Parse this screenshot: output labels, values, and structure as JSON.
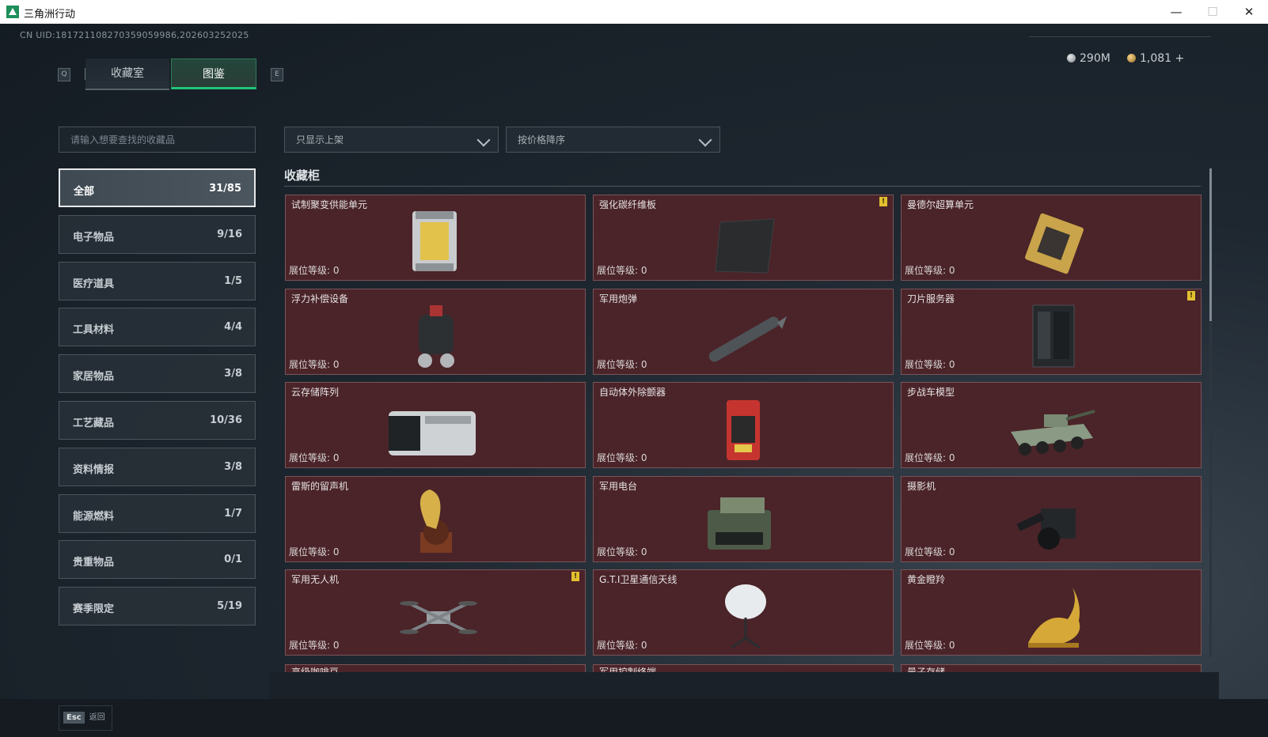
{
  "window": {
    "title": "三角洲行动",
    "min": "—",
    "max": "☐",
    "close": "✕"
  },
  "uid": "CN UID:181721108270359059986,202603252025",
  "currency": {
    "silver": "290M",
    "gold": "1,081 +"
  },
  "tabs": {
    "key_left": "Q",
    "key_right": "E",
    "items": [
      {
        "label": "收藏室",
        "active": false
      },
      {
        "label": "图鉴",
        "active": true
      }
    ]
  },
  "search": {
    "placeholder": "请输入想要查找的收藏品",
    "value": ""
  },
  "filters": {
    "shelf": "只显示上架",
    "sort": "按价格降序"
  },
  "categories": [
    {
      "label": "全部",
      "count": "31/85",
      "active": true
    },
    {
      "label": "电子物品",
      "count": "9/16"
    },
    {
      "label": "医疗道具",
      "count": "1/5"
    },
    {
      "label": "工具材料",
      "count": "4/4"
    },
    {
      "label": "家居物品",
      "count": "3/8"
    },
    {
      "label": "工艺藏品",
      "count": "10/36"
    },
    {
      "label": "资料情报",
      "count": "3/8"
    },
    {
      "label": "能源燃料",
      "count": "1/7"
    },
    {
      "label": "贵重物品",
      "count": "0/1"
    },
    {
      "label": "赛季限定",
      "count": "5/19"
    }
  ],
  "section_title": "收藏柜",
  "level_label": "展位等级: 0",
  "items": [
    {
      "name": "试制聚变供能单元",
      "icon": "fusion-unit-icon",
      "alert": false
    },
    {
      "name": "强化碳纤维板",
      "icon": "carbon-plate-icon",
      "alert": true
    },
    {
      "name": "曼德尔超算单元",
      "icon": "supercomputer-chip-icon",
      "alert": false
    },
    {
      "name": "浮力补偿设备",
      "icon": "buoyancy-device-icon",
      "alert": false
    },
    {
      "name": "军用炮弹",
      "icon": "artillery-shell-icon",
      "alert": false
    },
    {
      "name": "刀片服务器",
      "icon": "blade-server-icon",
      "alert": true
    },
    {
      "name": "云存储阵列",
      "icon": "storage-array-icon",
      "alert": false
    },
    {
      "name": "自动体外除颤器",
      "icon": "defibrillator-icon",
      "alert": false
    },
    {
      "name": "步战车模型",
      "icon": "ifv-model-icon",
      "alert": false
    },
    {
      "name": "雷斯的留声机",
      "icon": "gramophone-icon",
      "alert": false
    },
    {
      "name": "军用电台",
      "icon": "military-radio-icon",
      "alert": false
    },
    {
      "name": "摄影机",
      "icon": "camera-icon",
      "alert": false
    },
    {
      "name": "军用无人机",
      "icon": "drone-icon",
      "alert": true
    },
    {
      "name": "G.T.I卫星通信天线",
      "icon": "satellite-dish-icon",
      "alert": false
    },
    {
      "name": "黄金瞪羚",
      "icon": "golden-gazelle-icon",
      "alert": false
    }
  ],
  "partial_items": [
    "高级咖啡豆",
    "军用控制终端",
    "量子存储"
  ],
  "alert_mark": "!",
  "footer": {
    "key": "Esc",
    "label": "返回"
  }
}
